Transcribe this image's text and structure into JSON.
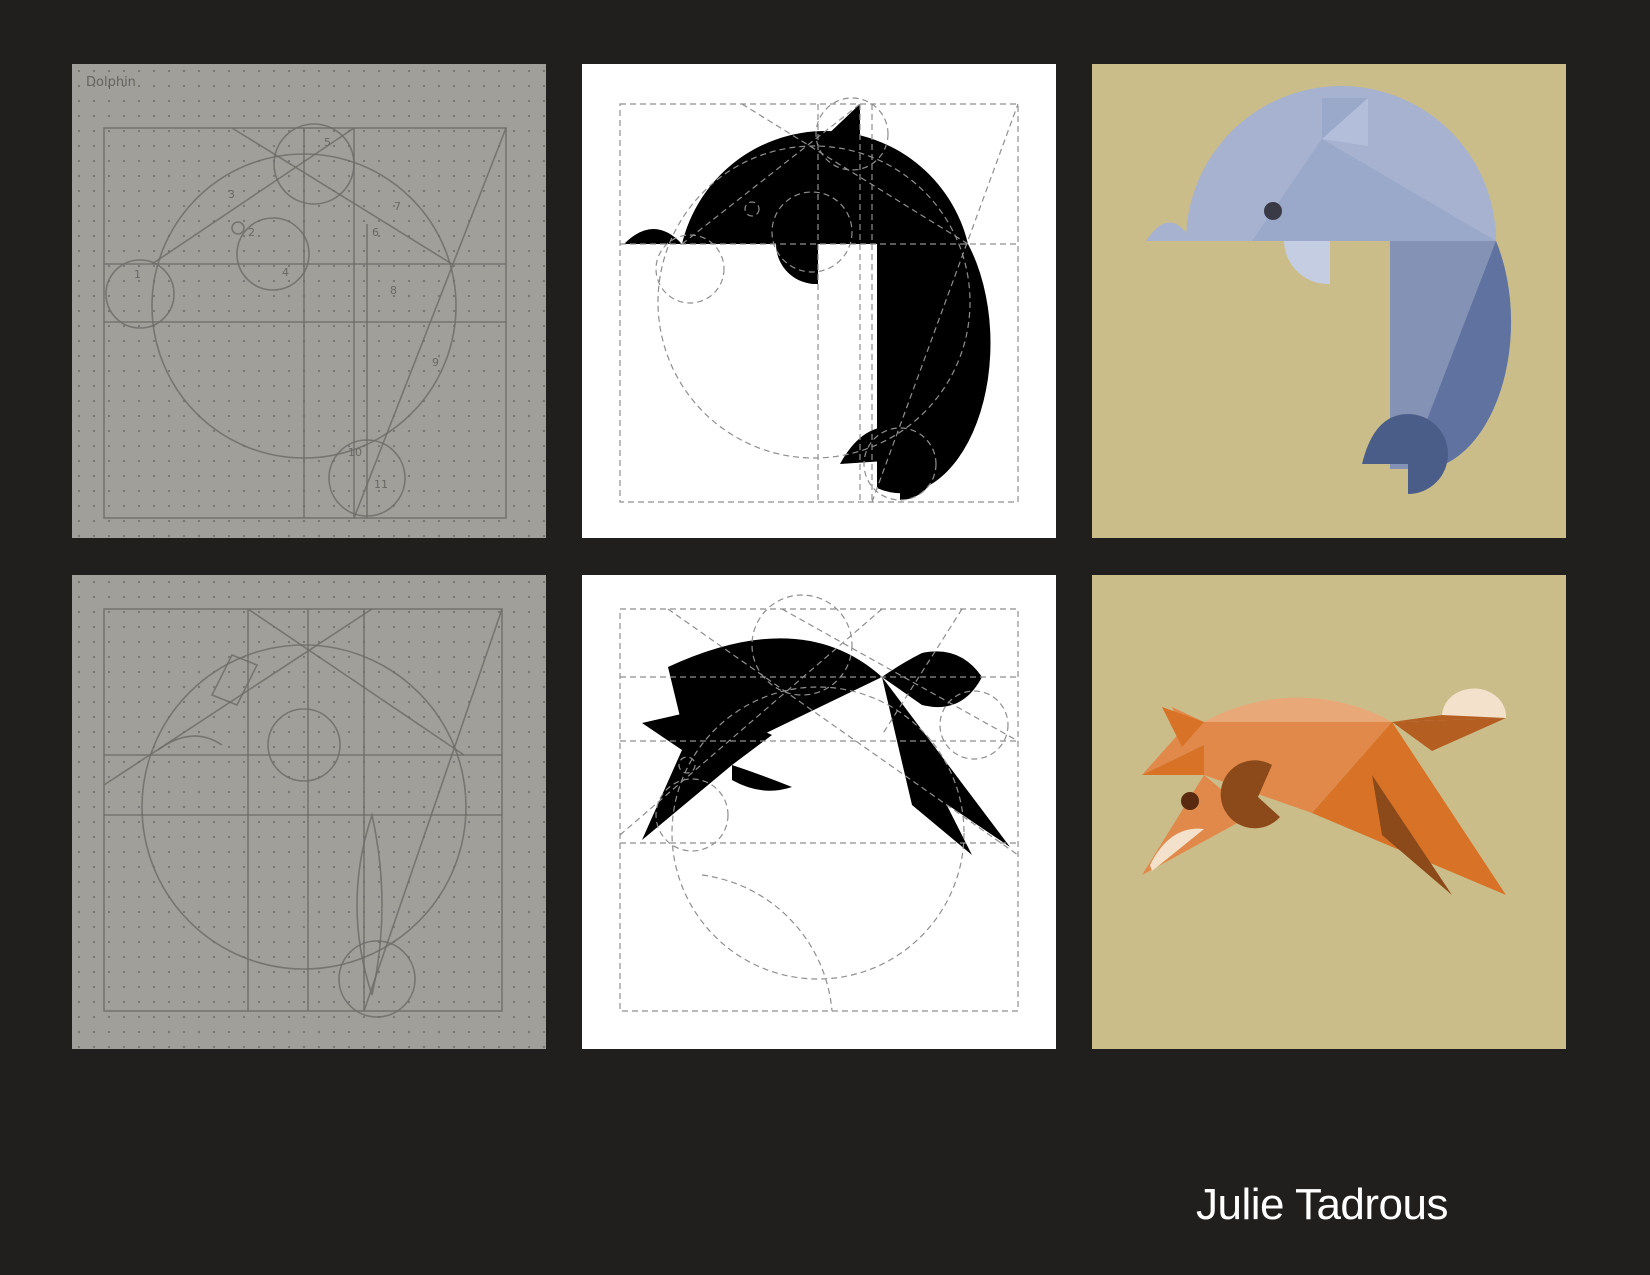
{
  "sketches": {
    "dolphin_title": "Dolphin",
    "dolphin_numbers": [
      "1",
      "2",
      "3",
      "4",
      "5",
      "6",
      "7",
      "8",
      "9",
      "10",
      "11"
    ]
  },
  "author": "Julie Tadrous",
  "colors": {
    "page_background": "#201f1e",
    "sketch_paper": "#a19f9a",
    "grid_panel": "#ffffff",
    "color_panel": "#cbbd89",
    "dolphin_light": "#a6b2cf",
    "dolphin_mid": "#8392b5",
    "dolphin_dark": "#5f72a0",
    "dolphin_tail": "#4a5d88",
    "fox_light": "#e8a878",
    "fox_mid": "#e0894a",
    "fox_orange": "#d87226",
    "fox_brown": "#9c4f1c",
    "fox_cream": "#f3e1cc",
    "eye": "#3a3a46"
  }
}
